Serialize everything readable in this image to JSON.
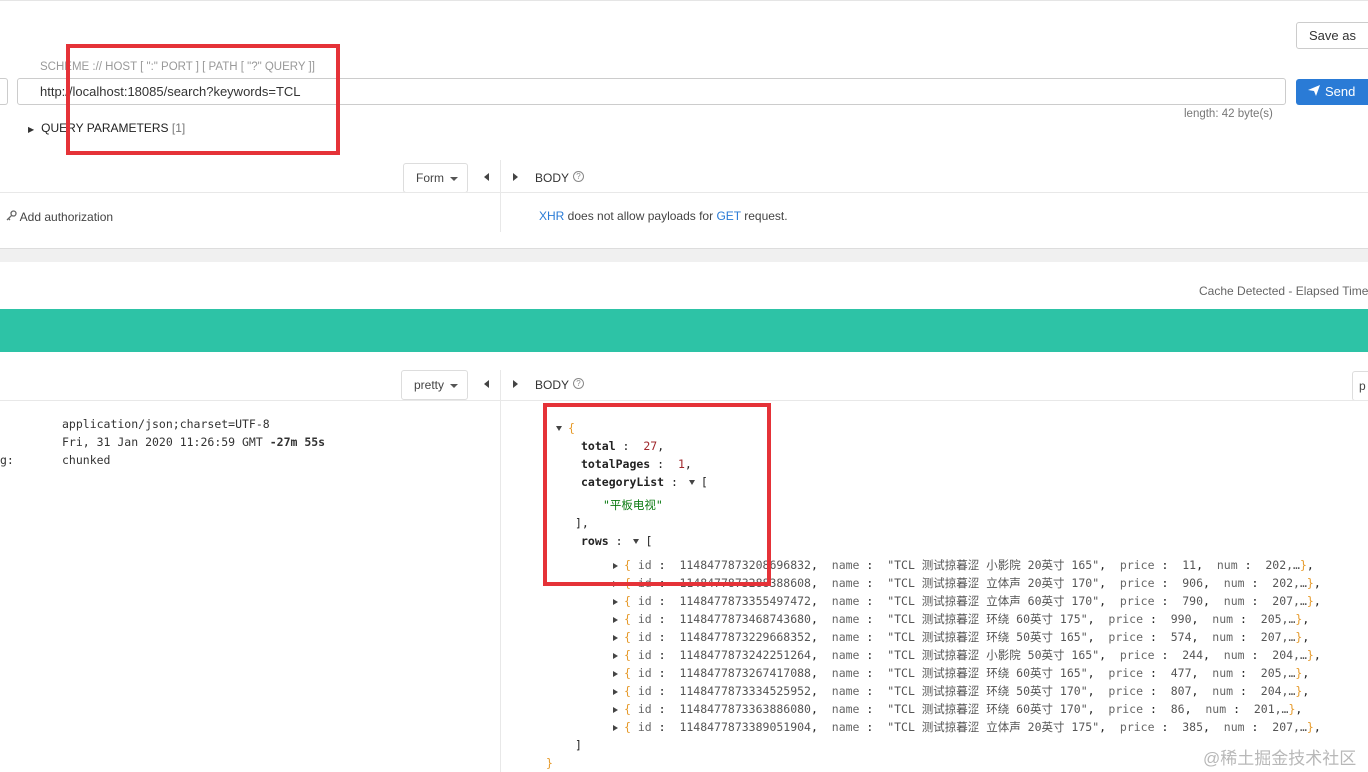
{
  "request": {
    "save_as_label": "Save as",
    "url_hint": "SCHEME :// HOST [ \":\" PORT ] [ PATH [ \"?\" QUERY ]]",
    "url": "http://localhost:18085/search?keywords=TCL",
    "send_label": "Send",
    "length_text": "length: 42 byte(s)",
    "query_params_label": "QUERY PARAMETERS",
    "query_params_count": "[1]",
    "form_label": "Form",
    "body_label": "BODY",
    "add_authorization": "Add authorization",
    "xhr_link": "XHR",
    "xhr_text": " does not allow payloads for ",
    "get_link": "GET",
    "request_word": " request."
  },
  "response": {
    "cache_text": "Cache Detected - Elapsed Time",
    "pretty_label": "pretty",
    "body_label": "BODY",
    "right_stub": "p",
    "headers": [
      {
        "key": "",
        "value": "application/json;charset=UTF-8"
      },
      {
        "key": "",
        "value": "Fri, 31 Jan 2020 11:26:59 GMT ",
        "extra": "-27m 55s"
      },
      {
        "key": "g:",
        "value": "chunked"
      }
    ],
    "json": {
      "open_brace": "{",
      "total_key": "total",
      "total_value": "27",
      "totalPages_key": "totalPages",
      "totalPages_value": "1",
      "categoryList_key": "categoryList",
      "category_item": "\"平板电视\"",
      "rows_key": "rows",
      "rows": [
        {
          "id": "1148477873208696832",
          "name": "\"TCL 测试掠暮涩 小影院 20英寸 165\"",
          "price": "11",
          "num": "202,…"
        },
        {
          "id": "1148477873288388608",
          "name": "\"TCL 测试掠暮涩 立体声 20英寸 170\"",
          "price": "906",
          "num": "202,…"
        },
        {
          "id": "1148477873355497472",
          "name": "\"TCL 测试掠暮涩 立体声 60英寸 170\"",
          "price": "790",
          "num": "207,…"
        },
        {
          "id": "1148477873468743680",
          "name": "\"TCL 测试掠暮涩 环绕 60英寸 175\"",
          "price": "990",
          "num": "205,…"
        },
        {
          "id": "1148477873229668352",
          "name": "\"TCL 测试掠暮涩 环绕 50英寸 165\"",
          "price": "574",
          "num": "207,…"
        },
        {
          "id": "1148477873242251264",
          "name": "\"TCL 测试掠暮涩 小影院 50英寸 165\"",
          "price": "244",
          "num": "204,…"
        },
        {
          "id": "1148477873267417088",
          "name": "\"TCL 测试掠暮涩 环绕 60英寸 165\"",
          "price": "477",
          "num": "205,…"
        },
        {
          "id": "1148477873334525952",
          "name": "\"TCL 测试掠暮涩 环绕 50英寸 170\"",
          "price": "807",
          "num": "204,…"
        },
        {
          "id": "1148477873363886080",
          "name": "\"TCL 测试掠暮涩 环绕 60英寸 170\"",
          "price": "86",
          "num": "201,…"
        },
        {
          "id": "1148477873389051904",
          "name": "\"TCL 测试掠暮涩 立体声 20英寸 175\"",
          "price": "385",
          "num": "207,…"
        }
      ],
      "close_bracket": "]",
      "close_brace": "}"
    }
  },
  "watermark": "@稀土掘金技术社区",
  "colors": {
    "send": "#2a7bd6",
    "status_bar": "#2dc3a6",
    "highlight_box": "#e53238"
  }
}
